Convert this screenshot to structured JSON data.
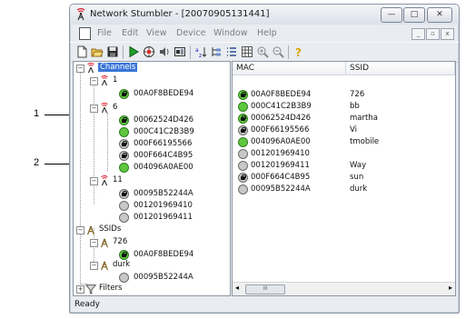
{
  "window": {
    "title": "Network Stumbler - [20070905131441]",
    "controls": {
      "minimize": "—",
      "maximize": "□",
      "close": "✕"
    }
  },
  "menu": [
    "File",
    "Edit",
    "View",
    "Device",
    "Window",
    "Help"
  ],
  "mdi_controls": {
    "minimize": "_",
    "restore": "▫",
    "close": "x"
  },
  "toolbar_icons": [
    "new-icon",
    "open-icon",
    "save-icon",
    "start-icon",
    "scan-icon",
    "sound-icon",
    "config-icon",
    "sort-icon",
    "tree-icon",
    "list-icon",
    "grid-icon",
    "zoom-in-icon",
    "zoom-out-icon",
    "help-icon"
  ],
  "tree": {
    "channels_label": "Channels",
    "channel_1": "1",
    "ch1_mac_1": "00A0F8BEDE94",
    "channel_6": "6",
    "ch6_mac_1": "00062524D426",
    "ch6_mac_2": "000C41C2B3B9",
    "ch6_mac_3": "000F66195566",
    "ch6_mac_4": "000F664C4B95",
    "ch6_mac_5": "004096A0AE00",
    "channel_11": "11",
    "ch11_mac_1": "00095B52244A",
    "ch11_mac_2": "001201969410",
    "ch11_mac_3": "001201969411",
    "ssids_label": "SSIDs",
    "ssid_1": "726",
    "ssid_1_mac": "00A0F8BEDE94",
    "ssid_2": "durk",
    "ssid_2_mac": "00095B52244A",
    "filters_label": "Filters"
  },
  "list": {
    "headers": {
      "mac": "MAC",
      "ssid": "SSID"
    },
    "rows": [
      {
        "mac": "00A0F8BEDE94",
        "ssid": "726"
      },
      {
        "mac": "000C41C2B3B9",
        "ssid": "bb"
      },
      {
        "mac": "00062524D426",
        "ssid": "martha"
      },
      {
        "mac": "000F66195566",
        "ssid": "Vi"
      },
      {
        "mac": "004096A0AE00",
        "ssid": "tmobile"
      },
      {
        "mac": "001201969410",
        "ssid": ""
      },
      {
        "mac": "001201969411",
        "ssid": "Way"
      },
      {
        "mac": "000F664C4B95",
        "ssid": "sun"
      },
      {
        "mac": "00095B52244A",
        "ssid": "durk"
      }
    ],
    "scroll_thumb": "III"
  },
  "status": "Ready",
  "callouts": {
    "one": "1",
    "two": "2"
  },
  "colors": {
    "selection": "#3875d7",
    "green_signal": "#5fc73e",
    "no_signal": "#c8c8c8"
  }
}
